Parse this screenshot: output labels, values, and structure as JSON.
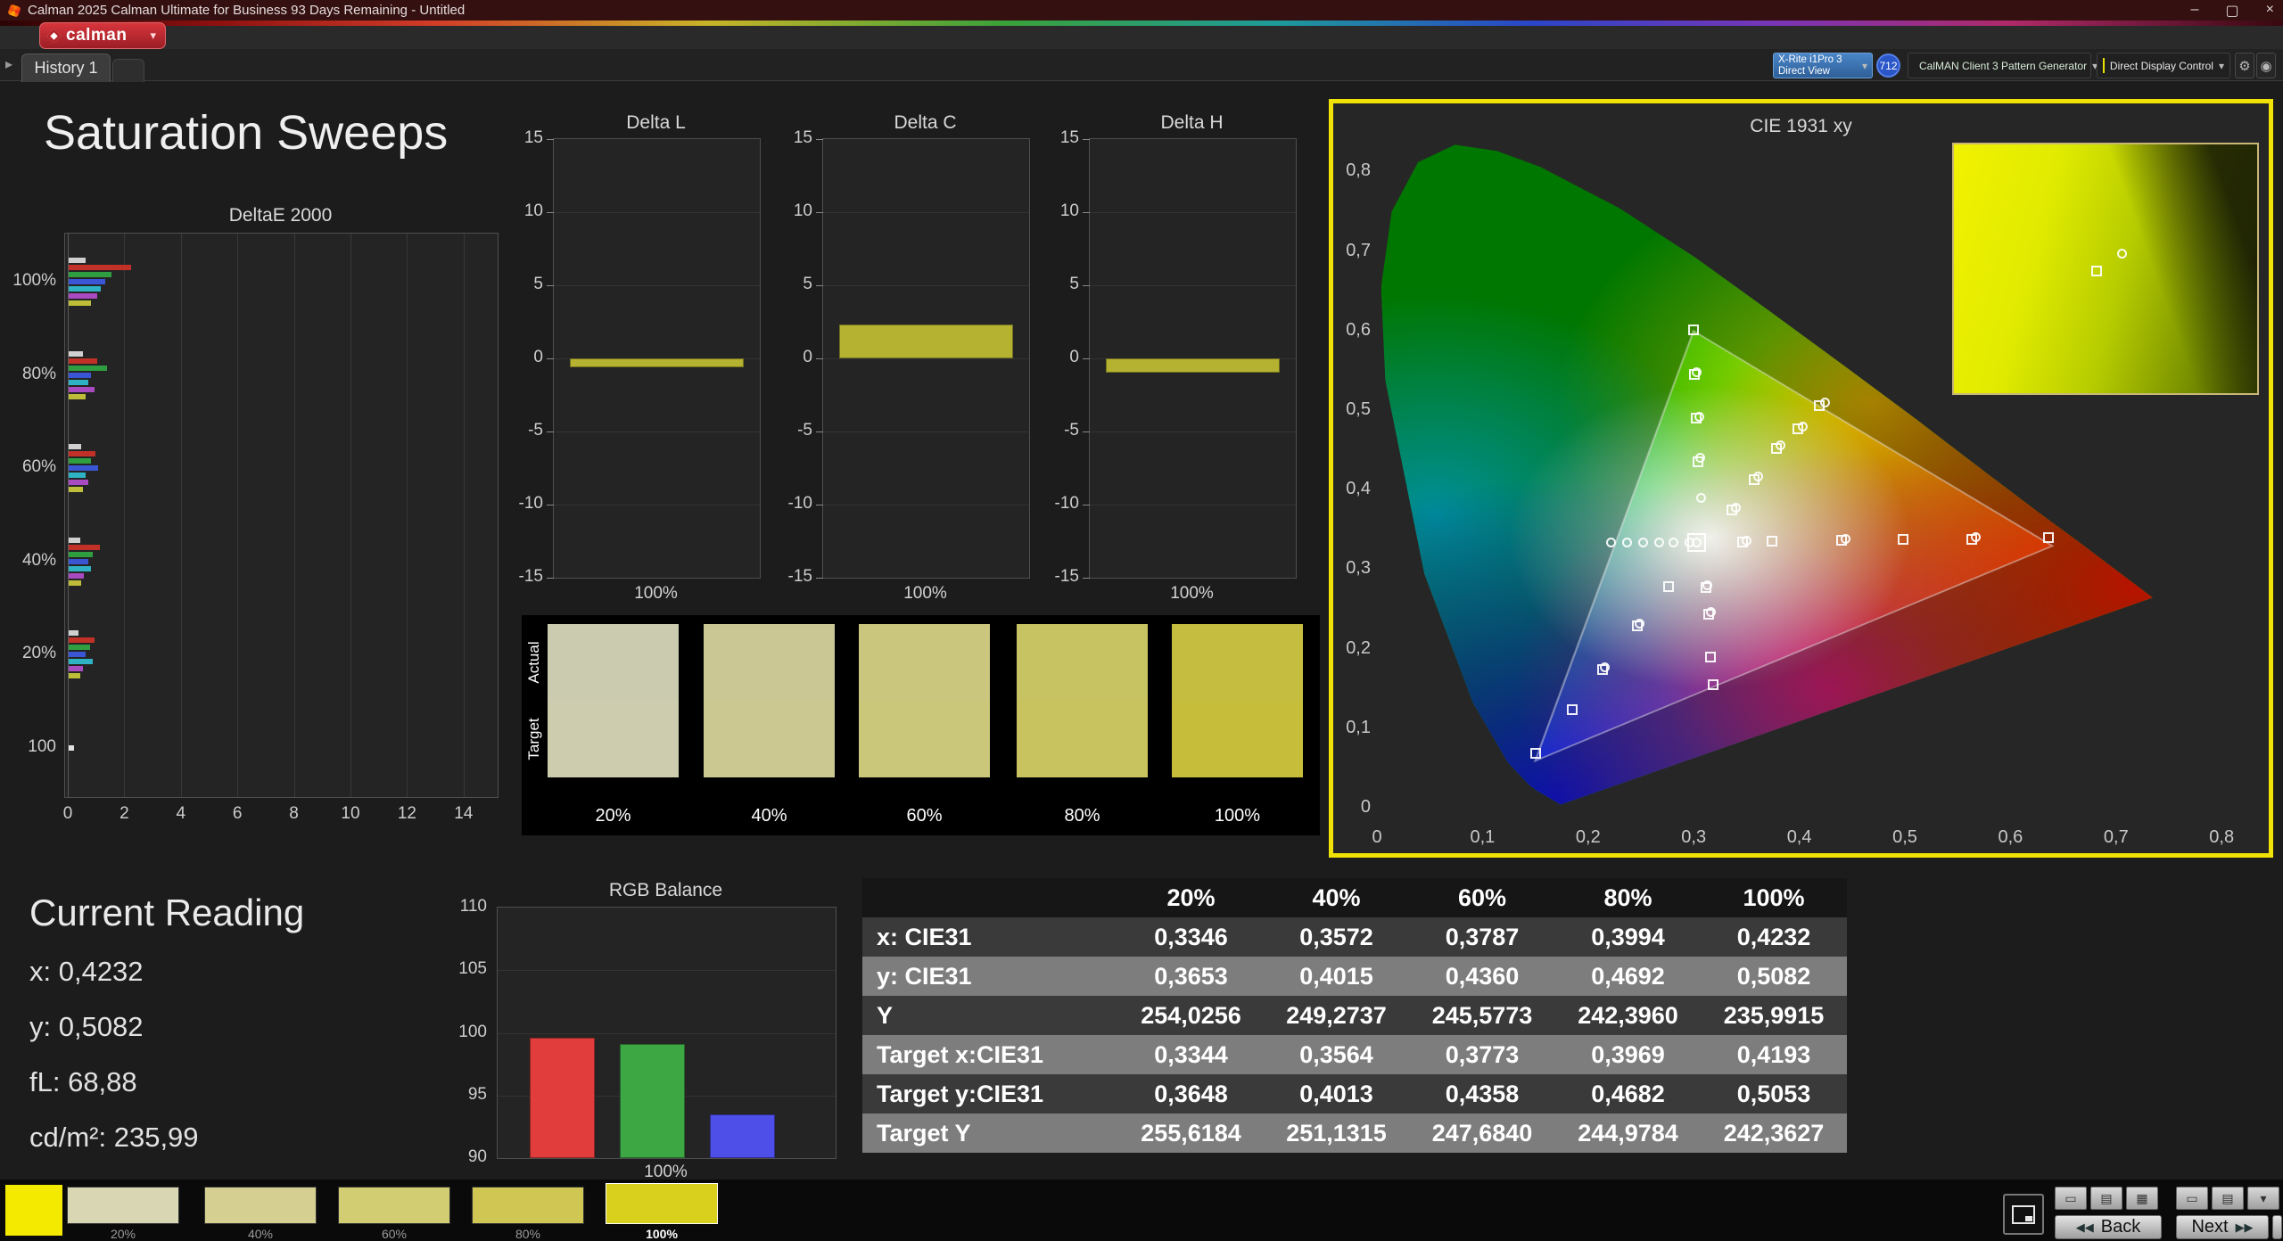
{
  "window": {
    "title": "Calman 2025 Calman Ultimate for Business 93 Days Remaining - Untitled",
    "controls": {
      "minimize": "–",
      "maximize": "▢",
      "close": "×"
    }
  },
  "logo": {
    "label": "calman"
  },
  "tabs": {
    "active": "History 1"
  },
  "devices": {
    "meter": {
      "line1": "X-Rite i1Pro 3",
      "line2": "Direct View"
    },
    "badge": "712",
    "pattern_generator": "CalMAN Client 3 Pattern Generator",
    "display_control": "Direct Display Control"
  },
  "icons": {
    "caret": "▾",
    "expander": "▸",
    "back_arrows": "◀◀",
    "next_arrows": "▶▶",
    "gear": "⚙",
    "power": "◉",
    "mini_a": [
      "▭",
      "▤",
      "▦"
    ],
    "mini_b": [
      "▭",
      "▤",
      "▾"
    ]
  },
  "page_title": "Saturation Sweeps",
  "current_reading": {
    "title": "Current Reading",
    "lines": [
      "x: 0,4232",
      "y: 0,5082",
      "fL: 68,88",
      "cd/m²: 235,99"
    ]
  },
  "charts": {
    "deltae2000": {
      "type": "grouped-bar-horizontal",
      "title": "DeltaE 2000",
      "x_ticks": [
        0,
        2,
        4,
        6,
        8,
        10,
        12,
        14
      ],
      "xlim": [
        0,
        15.3
      ],
      "groups": [
        {
          "label": "100%",
          "bars": [
            {
              "c": "#d0d0d0",
              "v": 0.6
            },
            {
              "c": "#c23127",
              "v": 2.2
            },
            {
              "c": "#2f9e40",
              "v": 1.5
            },
            {
              "c": "#3a56d4",
              "v": 1.3
            },
            {
              "c": "#2fb3c4",
              "v": 1.15
            },
            {
              "c": "#a94bc0",
              "v": 1.0
            },
            {
              "c": "#bdbd3a",
              "v": 0.8
            }
          ]
        },
        {
          "label": "80%",
          "bars": [
            {
              "c": "#d0d0d0",
              "v": 0.5
            },
            {
              "c": "#c23127",
              "v": 1.0
            },
            {
              "c": "#2f9e40",
              "v": 1.35
            },
            {
              "c": "#3a56d4",
              "v": 0.8
            },
            {
              "c": "#2fb3c4",
              "v": 0.7
            },
            {
              "c": "#a94bc0",
              "v": 0.9
            },
            {
              "c": "#bdbd3a",
              "v": 0.6
            }
          ]
        },
        {
          "label": "60%",
          "bars": [
            {
              "c": "#d0d0d0",
              "v": 0.45
            },
            {
              "c": "#c23127",
              "v": 0.95
            },
            {
              "c": "#2f9e40",
              "v": 0.8
            },
            {
              "c": "#3a56d4",
              "v": 1.05
            },
            {
              "c": "#2fb3c4",
              "v": 0.6
            },
            {
              "c": "#a94bc0",
              "v": 0.7
            },
            {
              "c": "#bdbd3a",
              "v": 0.5
            }
          ]
        },
        {
          "label": "40%",
          "bars": [
            {
              "c": "#d0d0d0",
              "v": 0.4
            },
            {
              "c": "#c23127",
              "v": 1.1
            },
            {
              "c": "#2f9e40",
              "v": 0.85
            },
            {
              "c": "#3a56d4",
              "v": 0.7
            },
            {
              "c": "#2fb3c4",
              "v": 0.8
            },
            {
              "c": "#a94bc0",
              "v": 0.55
            },
            {
              "c": "#bdbd3a",
              "v": 0.45
            }
          ]
        },
        {
          "label": "20%",
          "bars": [
            {
              "c": "#d0d0d0",
              "v": 0.35
            },
            {
              "c": "#c23127",
              "v": 0.9
            },
            {
              "c": "#2f9e40",
              "v": 0.75
            },
            {
              "c": "#3a56d4",
              "v": 0.6
            },
            {
              "c": "#2fb3c4",
              "v": 0.85
            },
            {
              "c": "#a94bc0",
              "v": 0.5
            },
            {
              "c": "#bdbd3a",
              "v": 0.4
            }
          ]
        },
        {
          "label": "100",
          "bars": [
            {
              "c": "#e0e0e0",
              "v": 0.18
            }
          ]
        }
      ]
    },
    "delta_l": {
      "type": "bar",
      "title": "Delta L",
      "y_ticks": [
        15,
        10,
        5,
        0,
        -5,
        -10,
        -15
      ],
      "ylim": [
        -15,
        15
      ],
      "x_label": "100%",
      "value": -0.6,
      "bar_color": "#b5b232"
    },
    "delta_c": {
      "type": "bar",
      "title": "Delta C",
      "y_ticks": [
        15,
        10,
        5,
        0,
        -5,
        -10,
        -15
      ],
      "ylim": [
        -15,
        15
      ],
      "x_label": "100%",
      "value": 2.3,
      "bar_color": "#b5b232"
    },
    "delta_h": {
      "type": "bar",
      "title": "Delta H",
      "y_ticks": [
        15,
        10,
        5,
        0,
        -5,
        -10,
        -15
      ],
      "ylim": [
        -15,
        15
      ],
      "x_label": "100%",
      "value": -1.0,
      "bar_color": "#b5b232"
    },
    "rgb_balance": {
      "type": "bar",
      "title": "RGB Balance",
      "y_ticks": [
        110,
        105,
        100,
        95,
        90
      ],
      "ylim": [
        90,
        110
      ],
      "x_label": "100%",
      "bars": [
        {
          "name": "red",
          "color": "#e23d3d",
          "value": 99.6
        },
        {
          "name": "green",
          "color": "#3da843",
          "value": 99.1
        },
        {
          "name": "blue",
          "color": "#4e4ee8",
          "value": 93.5
        }
      ]
    },
    "cie": {
      "type": "scatter",
      "title": "CIE 1931 xy",
      "x_tick_vals": [
        0,
        0.1,
        0.2,
        0.3,
        0.4,
        0.5,
        0.6,
        0.7,
        0.8
      ],
      "x_tick_labels": [
        "0",
        "0,1",
        "0,2",
        "0,3",
        "0,4",
        "0,5",
        "0,6",
        "0,7",
        "0,8"
      ],
      "y_tick_vals": [
        0,
        0.1,
        0.2,
        0.3,
        0.4,
        0.5,
        0.6,
        0.7,
        0.8
      ],
      "y_tick_labels": [
        "0",
        "0,1",
        "0,2",
        "0,3",
        "0,4",
        "0,5",
        "0,6",
        "0,7",
        "0,8"
      ],
      "gamut_triangle": [
        [
          0.64,
          0.33
        ],
        [
          0.3,
          0.6
        ],
        [
          0.15,
          0.06
        ]
      ],
      "squares": [
        [
          0.346,
          0.334
        ],
        [
          0.374,
          0.335
        ],
        [
          0.44,
          0.336
        ],
        [
          0.498,
          0.337
        ],
        [
          0.563,
          0.338
        ],
        [
          0.636,
          0.34
        ],
        [
          0.304,
          0.435
        ],
        [
          0.302,
          0.49
        ],
        [
          0.301,
          0.545
        ],
        [
          0.3,
          0.601
        ],
        [
          0.276,
          0.278
        ],
        [
          0.247,
          0.229
        ],
        [
          0.214,
          0.174
        ],
        [
          0.185,
          0.123
        ],
        [
          0.15,
          0.068
        ],
        [
          0.312,
          0.277
        ],
        [
          0.314,
          0.243
        ],
        [
          0.316,
          0.19
        ],
        [
          0.318,
          0.155
        ],
        [
          0.336,
          0.374
        ],
        [
          0.357,
          0.412
        ],
        [
          0.378,
          0.452
        ],
        [
          0.399,
          0.477
        ],
        [
          0.419,
          0.506
        ]
      ],
      "circles": [
        [
          0.222,
          0.333
        ],
        [
          0.237,
          0.333
        ],
        [
          0.252,
          0.333
        ],
        [
          0.267,
          0.333
        ],
        [
          0.281,
          0.333
        ],
        [
          0.296,
          0.333
        ],
        [
          0.303,
          0.334
        ],
        [
          0.34,
          0.377
        ],
        [
          0.361,
          0.416
        ],
        [
          0.382,
          0.456
        ],
        [
          0.403,
          0.479
        ],
        [
          0.424,
          0.509
        ],
        [
          0.307,
          0.39
        ],
        [
          0.306,
          0.44
        ],
        [
          0.305,
          0.492
        ],
        [
          0.303,
          0.548
        ],
        [
          0.35,
          0.336
        ],
        [
          0.444,
          0.338
        ],
        [
          0.567,
          0.34
        ],
        [
          0.313,
          0.28
        ],
        [
          0.316,
          0.246
        ],
        [
          0.249,
          0.231
        ],
        [
          0.216,
          0.177
        ]
      ],
      "highlight": [
        0.303,
        0.334
      ],
      "inset": {
        "square": [
          0.47,
          0.51
        ],
        "circle": [
          0.555,
          0.44
        ]
      }
    }
  },
  "swatch_panel": {
    "row_labels": [
      "Actual",
      "Target"
    ],
    "columns": [
      {
        "label": "20%",
        "actual": "#cbcbb0",
        "target": "#cdccae"
      },
      {
        "label": "40%",
        "actual": "#cbc795",
        "target": "#ccc892"
      },
      {
        "label": "60%",
        "actual": "#cac67e",
        "target": "#cbc77a"
      },
      {
        "label": "80%",
        "actual": "#c7c262",
        "target": "#c8c35e"
      },
      {
        "label": "100%",
        "actual": "#c5bd40",
        "target": "#c6be3b"
      }
    ]
  },
  "table": {
    "columns": [
      "20%",
      "40%",
      "60%",
      "80%",
      "100%"
    ],
    "rows": [
      {
        "label": "x: CIE31",
        "values": [
          "0,3346",
          "0,3572",
          "0,3787",
          "0,3994",
          "0,4232"
        ]
      },
      {
        "label": "y: CIE31",
        "values": [
          "0,3653",
          "0,4015",
          "0,4360",
          "0,4692",
          "0,5082"
        ]
      },
      {
        "label": "Y",
        "values": [
          "254,0256",
          "249,2737",
          "245,5773",
          "242,3960",
          "235,9915"
        ]
      },
      {
        "label": "Target x:CIE31",
        "values": [
          "0,3344",
          "0,3564",
          "0,3773",
          "0,3969",
          "0,4193"
        ]
      },
      {
        "label": "Target y:CIE31",
        "values": [
          "0,3648",
          "0,4013",
          "0,4358",
          "0,4682",
          "0,5053"
        ]
      },
      {
        "label": "Target Y",
        "values": [
          "255,6184",
          "251,1315",
          "247,6840",
          "244,9784",
          "242,3627"
        ]
      }
    ]
  },
  "bottom": {
    "pattern_color": "#f4ea00",
    "swatches": [
      {
        "label": "20%",
        "color": "#d9d6b4",
        "selected": false
      },
      {
        "label": "40%",
        "color": "#d5d092",
        "selected": false
      },
      {
        "label": "60%",
        "color": "#d2cc73",
        "selected": false
      },
      {
        "label": "80%",
        "color": "#cfc654",
        "selected": false
      },
      {
        "label": "100%",
        "color": "#d9d01e",
        "selected": true
      }
    ],
    "back_label": "Back",
    "next_label": "Next"
  }
}
